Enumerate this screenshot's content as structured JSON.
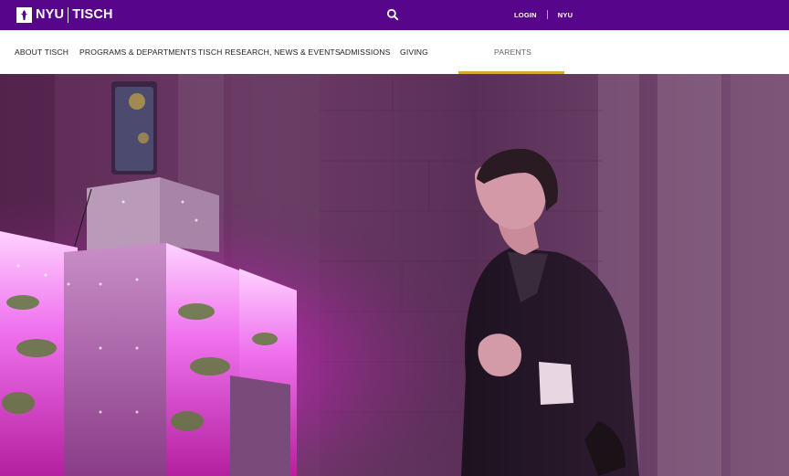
{
  "brand": {
    "nyu": "NYU",
    "tisch": "TISCH"
  },
  "utility": {
    "login_label": "LOGIN",
    "nyu_label": "NYU"
  },
  "nav": {
    "items": [
      {
        "label": "ABOUT TISCH"
      },
      {
        "label": "PROGRAMS & DEPARTMENTS"
      },
      {
        "label": "TISCH RESEARCH, NEWS & EVENTS"
      },
      {
        "label": "ADMISSIONS"
      },
      {
        "label": "GIVING"
      },
      {
        "label": "PARENTS"
      }
    ],
    "active_index": 5
  },
  "colors": {
    "brand_purple": "#57068c",
    "accent_gold": "#d8a730"
  },
  "icons": {
    "search": "search-icon",
    "logo": "nyu-torch-icon"
  }
}
